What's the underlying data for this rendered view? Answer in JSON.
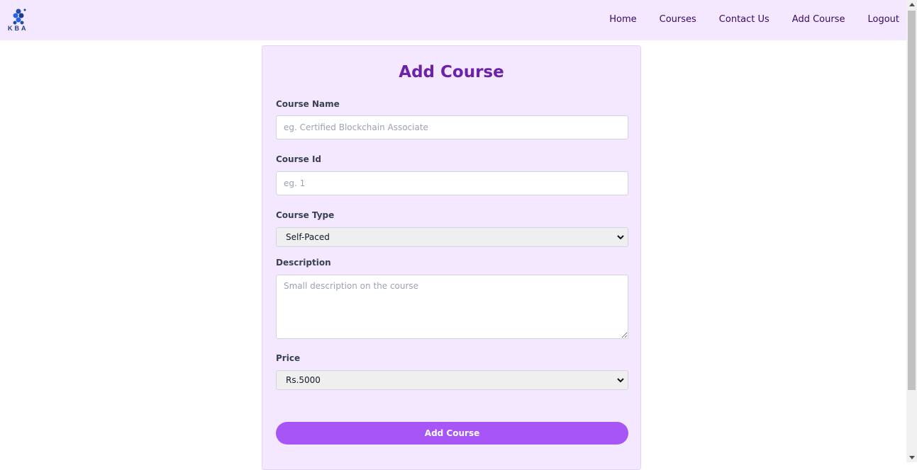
{
  "nav": {
    "logo_text": "KBA",
    "links": [
      {
        "label": "Home"
      },
      {
        "label": "Courses"
      },
      {
        "label": "Contact Us"
      },
      {
        "label": "Add Course"
      },
      {
        "label": "Logout"
      }
    ]
  },
  "form": {
    "title": "Add Course",
    "course_name": {
      "label": "Course Name",
      "value": "",
      "placeholder": "eg. Certified Blockchain Associate"
    },
    "course_id": {
      "label": "Course Id",
      "value": "",
      "placeholder": "eg. 1"
    },
    "course_type": {
      "label": "Course Type",
      "selected": "Self-Paced"
    },
    "description": {
      "label": "Description",
      "value": "",
      "placeholder": "Small description on the course"
    },
    "price": {
      "label": "Price",
      "selected": "Rs.5000"
    },
    "submit_label": "Add Course"
  },
  "colors": {
    "nav_bg": "#f3e8ff",
    "card_bg": "#f3e8ff",
    "title": "#6b21a8",
    "button": "#a855f7"
  },
  "icons": {
    "logo": "kba-logo",
    "select_arrow": "chevron-down-icon"
  }
}
